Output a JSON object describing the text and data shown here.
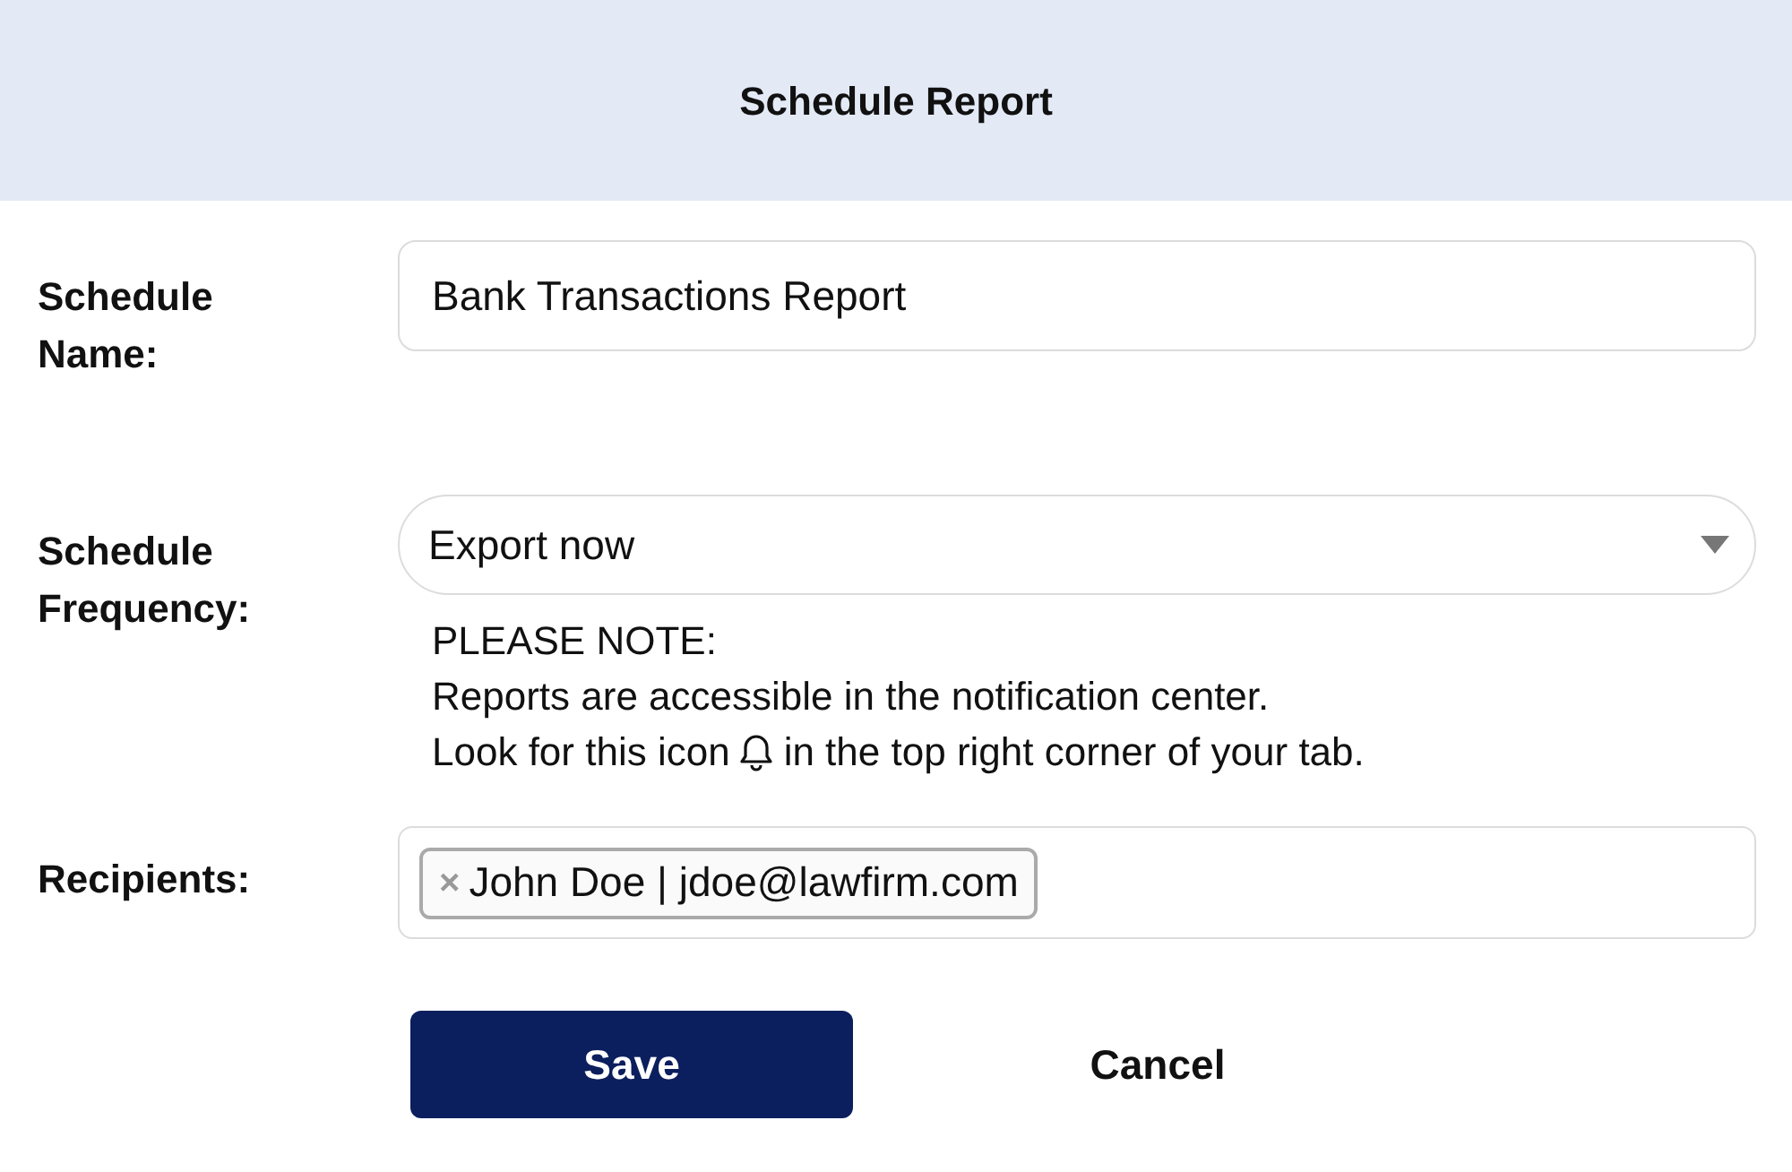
{
  "title": "Schedule Report",
  "fields": [
    {
      "kind": "text",
      "label": "Schedule Name:",
      "value": "Bank Transactions Report"
    },
    {
      "kind": "select",
      "label": "Schedule Frequency:",
      "value": "Export now",
      "note": {
        "lines": [
          "PLEASE NOTE:",
          "Reports are accessible in the notification center."
        ],
        "icon_line": {
          "before": "Look for this icon",
          "after": "in the top right corner of your tab."
        }
      }
    },
    {
      "kind": "tags",
      "label": "Recipients:",
      "tags": [
        {
          "remove": "×",
          "label": "John Doe | jdoe@lawfirm.com"
        }
      ]
    }
  ],
  "buttons": [
    {
      "kind": "primary",
      "label": "Save"
    },
    {
      "kind": "secondary",
      "label": "Cancel"
    }
  ]
}
